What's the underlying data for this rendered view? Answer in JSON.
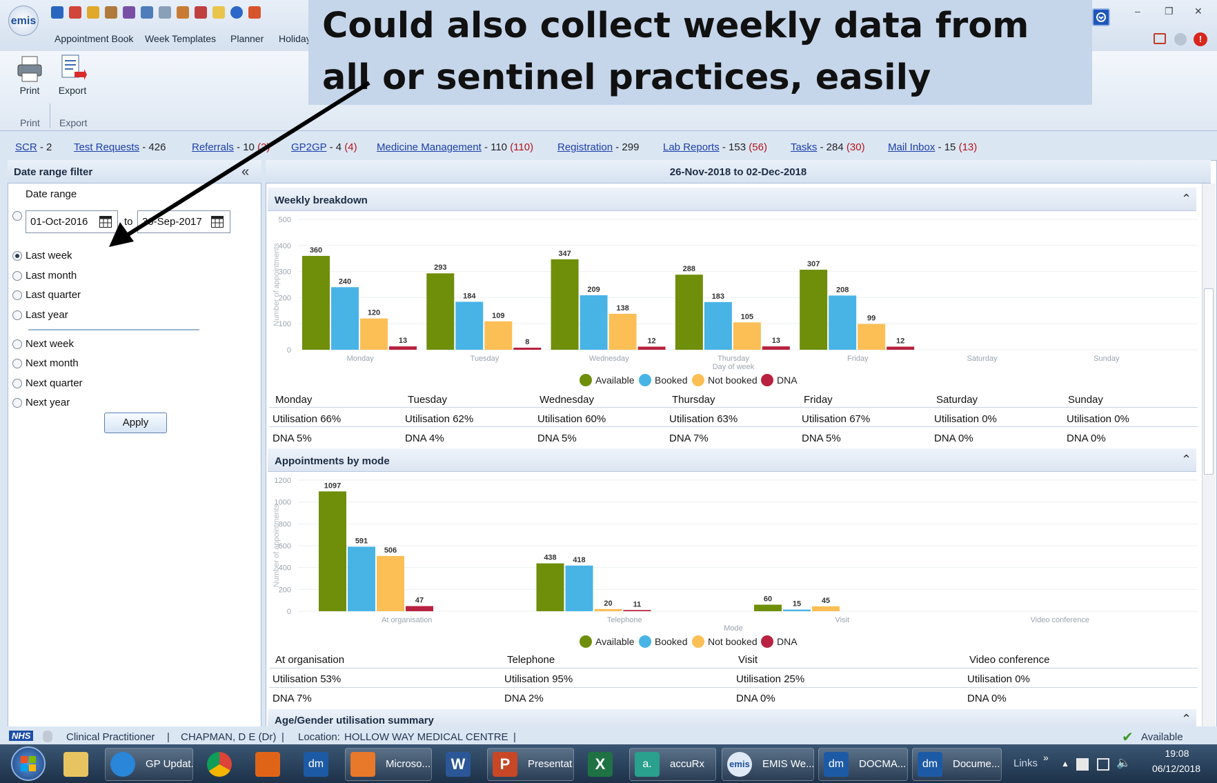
{
  "app": {
    "logo": "emis",
    "menu": [
      "Appointment Book",
      "Week Templates",
      "Planner",
      "Holiday"
    ],
    "ribbon": {
      "print_label": "Print",
      "export_label": "Export",
      "print_group": "Print",
      "export_group": "Export"
    }
  },
  "callout": {
    "text": "Could also collect weekly data from all or sentinel practices, easily"
  },
  "links": [
    {
      "name": "SCR",
      "count": "- 2",
      "extra": ""
    },
    {
      "name": "Test Requests",
      "count": "- 426",
      "extra": ""
    },
    {
      "name": "Referrals",
      "count": "- 10",
      "extra": "(2)"
    },
    {
      "name": "GP2GP",
      "count": "- 4",
      "extra": "(4)"
    },
    {
      "name": "Medicine Management",
      "count": "- 110",
      "extra": "(110)"
    },
    {
      "name": "Registration",
      "count": "- 299",
      "extra": ""
    },
    {
      "name": "Lab Reports",
      "count": "- 153",
      "extra": "(56)"
    },
    {
      "name": "Tasks",
      "count": "- 284",
      "extra": "(30)"
    },
    {
      "name": "Mail Inbox",
      "count": "- 15",
      "extra": "(13)"
    }
  ],
  "filter": {
    "title": "Date range filter",
    "collapse_glyph": "«",
    "date_range_label": "Date range",
    "from_date": "01-Oct-2016",
    "to_label": "to",
    "to_date": "30-Sep-2017",
    "options_past": [
      "Last week",
      "Last month",
      "Last quarter",
      "Last year"
    ],
    "options_future": [
      "Next week",
      "Next month",
      "Next quarter",
      "Next year"
    ],
    "selected": "Last week",
    "apply_label": "Apply"
  },
  "main": {
    "period": "26-Nov-2018 to 02-Dec-2018",
    "weekly": {
      "title": "Weekly breakdown",
      "table_headers": [
        "Monday",
        "Tuesday",
        "Wednesday",
        "Thursday",
        "Friday",
        "Saturday",
        "Sunday"
      ],
      "utilisation": [
        "Utilisation 66%",
        "Utilisation 62%",
        "Utilisation 60%",
        "Utilisation 63%",
        "Utilisation 67%",
        "Utilisation 0%",
        "Utilisation 0%"
      ],
      "dna": [
        "DNA 5%",
        "DNA 4%",
        "DNA 5%",
        "DNA 7%",
        "DNA 5%",
        "DNA 0%",
        "DNA 0%"
      ]
    },
    "mode": {
      "title": "Appointments by mode",
      "table_headers": [
        "At organisation",
        "Telephone",
        "Visit",
        "Video conference"
      ],
      "utilisation": [
        "Utilisation 53%",
        "Utilisation 95%",
        "Utilisation 25%",
        "Utilisation 0%"
      ],
      "dna": [
        "DNA 7%",
        "DNA 2%",
        "DNA 0%",
        "DNA 0%"
      ]
    },
    "age_gender": {
      "title": "Age/Gender utilisation summary"
    },
    "legend": [
      "Available",
      "Booked",
      "Not booked",
      "DNA"
    ]
  },
  "colors": {
    "available": "#6f8e0a",
    "booked": "#48b4e6",
    "not_booked": "#fbbf55",
    "dna": "#b8213f"
  },
  "chart_data": [
    {
      "type": "bar",
      "title": "",
      "xlabel": "Day of week",
      "ylabel": "Number of appointments",
      "ylim": [
        0,
        500
      ],
      "yticks": [
        0,
        100,
        200,
        300,
        400,
        500
      ],
      "categories": [
        "Monday",
        "Tuesday",
        "Wednesday",
        "Thursday",
        "Friday",
        "Saturday",
        "Sunday"
      ],
      "series": [
        {
          "name": "Available",
          "values": [
            360,
            293,
            347,
            288,
            307,
            0,
            0
          ]
        },
        {
          "name": "Booked",
          "values": [
            240,
            184,
            209,
            183,
            208,
            0,
            0
          ]
        },
        {
          "name": "Not booked",
          "values": [
            120,
            109,
            138,
            105,
            99,
            0,
            0
          ]
        },
        {
          "name": "DNA",
          "values": [
            13,
            8,
            12,
            13,
            12,
            0,
            0
          ]
        }
      ],
      "legend": "bottom"
    },
    {
      "type": "bar",
      "title": "",
      "xlabel": "Mode",
      "ylabel": "Number of appointments",
      "ylim": [
        0,
        1200
      ],
      "yticks": [
        0,
        200,
        400,
        600,
        800,
        1000,
        1200
      ],
      "categories": [
        "At organisation",
        "Telephone",
        "Visit",
        "Video conference"
      ],
      "series": [
        {
          "name": "Available",
          "values": [
            1097,
            438,
            60,
            0
          ]
        },
        {
          "name": "Booked",
          "values": [
            591,
            418,
            15,
            0
          ]
        },
        {
          "name": "Not booked",
          "values": [
            506,
            20,
            45,
            0
          ]
        },
        {
          "name": "DNA",
          "values": [
            47,
            11,
            0,
            0
          ]
        }
      ],
      "legend": "bottom"
    }
  ],
  "status": {
    "nhs": "NHS",
    "role": "Clinical Practitioner",
    "user": "CHAPMAN, D E (Dr)",
    "location_label": "Location:",
    "location": "HOLLOW WAY MEDICAL CENTRE",
    "availability": "Available"
  },
  "taskbar": {
    "items": [
      "GP Updat...",
      "Microso...",
      "Presentat...",
      "accuRx",
      "EMIS We...",
      "DOCMA...",
      "Docume..."
    ],
    "links_label": "Links",
    "time": "19:08",
    "date": "06/12/2018"
  }
}
